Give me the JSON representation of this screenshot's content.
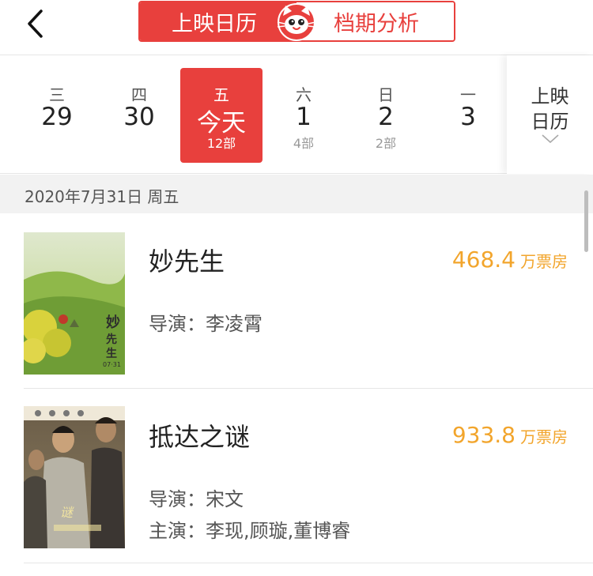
{
  "header": {
    "tabs": [
      {
        "label": "上映日历",
        "active": true
      },
      {
        "label": "档期分析",
        "active": false
      }
    ],
    "brand_color": "#e8403d"
  },
  "date_strip": {
    "days": [
      {
        "weekday": "三",
        "date": "29",
        "count": ""
      },
      {
        "weekday": "四",
        "date": "30",
        "count": ""
      },
      {
        "weekday": "五",
        "date": "今天",
        "count": "12部",
        "active": true
      },
      {
        "weekday": "六",
        "date": "1",
        "count": "4部"
      },
      {
        "weekday": "日",
        "date": "2",
        "count": "2部"
      },
      {
        "weekday": "一",
        "date": "3",
        "count": ""
      }
    ],
    "calendar_button": {
      "line1": "上映",
      "line2": "日历"
    }
  },
  "date_header": "2020年7月31日 周五",
  "movies": [
    {
      "title": "妙先生",
      "box_office": "468.4",
      "box_office_unit": "万票房",
      "director": "导演：李凌霄",
      "poster_text": "07·31"
    },
    {
      "title": "抵达之谜",
      "box_office": "933.8",
      "box_office_unit": "万票房",
      "director": "导演：宋文",
      "cast": "主演：李现,顾璇,董博睿"
    }
  ],
  "colors": {
    "accent": "#e8403d",
    "box_office": "#f2a52c",
    "section_bg": "#f2f2f2"
  }
}
